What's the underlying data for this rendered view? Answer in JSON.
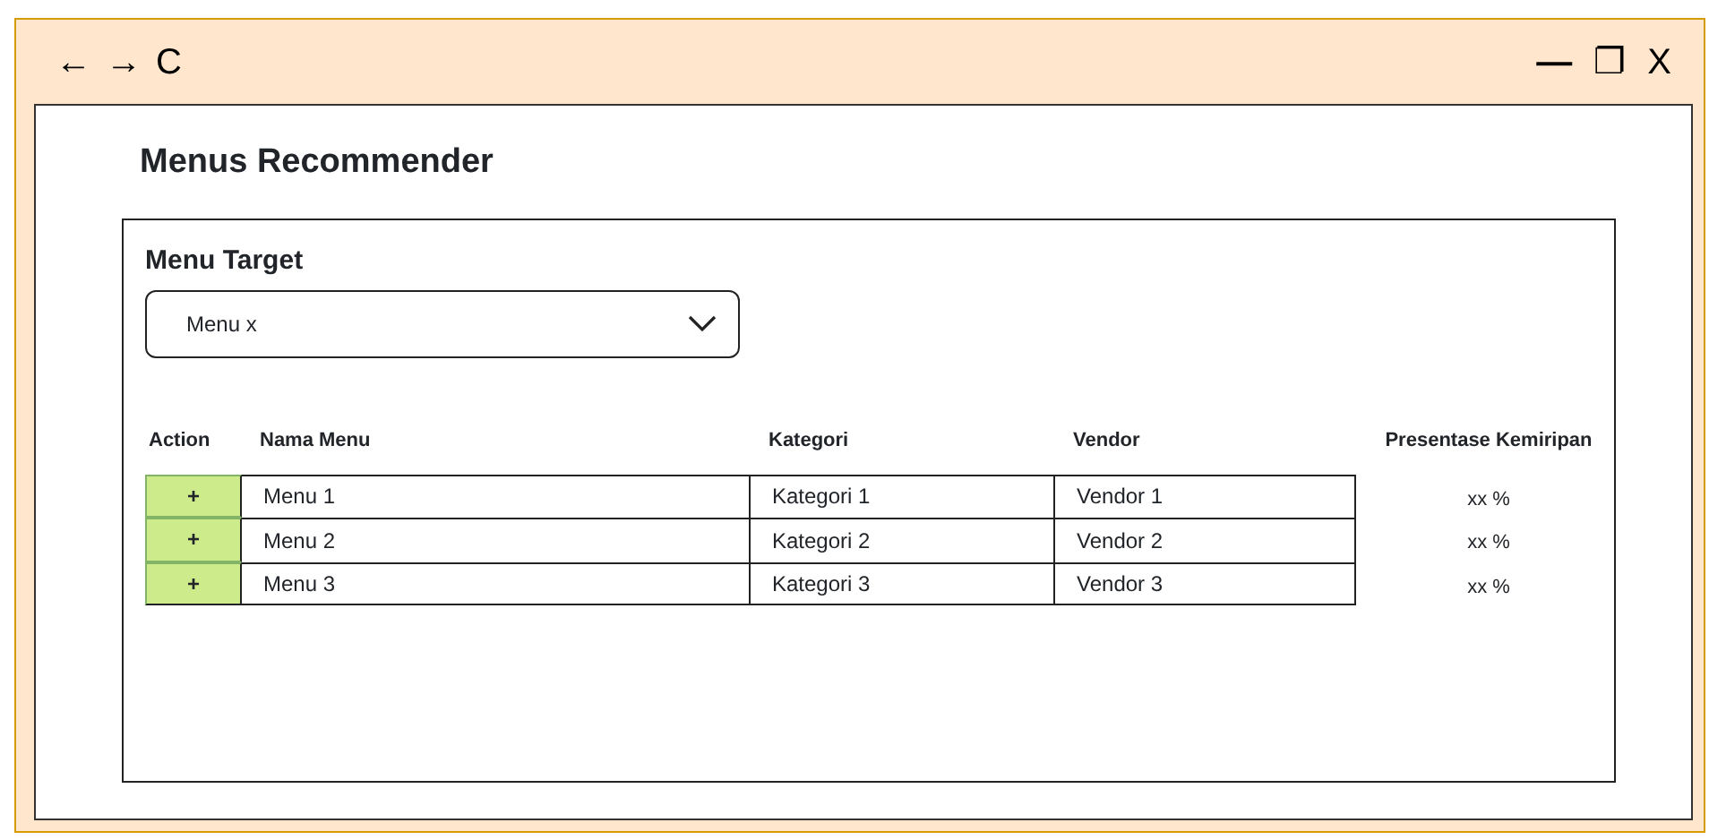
{
  "toolbar": {
    "back": "←",
    "forward": "→",
    "reload": "C",
    "minimize": "—",
    "restore": "❐",
    "close": "X"
  },
  "title": "Menus Recommender",
  "menu_target": {
    "label": "Menu Target",
    "value": "Menu x"
  },
  "table": {
    "columns": [
      "Action",
      "Nama Menu",
      "Kategori",
      "Vendor",
      "Presentase Kemiripan"
    ],
    "rows": [
      {
        "action": "+",
        "nama_menu": "Menu 1",
        "kategori": "Kategori 1",
        "vendor": "Vendor 1",
        "presentase": "xx %"
      },
      {
        "action": "+",
        "nama_menu": "Menu 2",
        "kategori": "Kategori 2",
        "vendor": "Vendor 2",
        "presentase": "xx %"
      },
      {
        "action": "+",
        "nama_menu": "Menu 3",
        "kategori": "Kategori 3",
        "vendor": "Vendor 3",
        "presentase": "xx %"
      }
    ]
  }
}
